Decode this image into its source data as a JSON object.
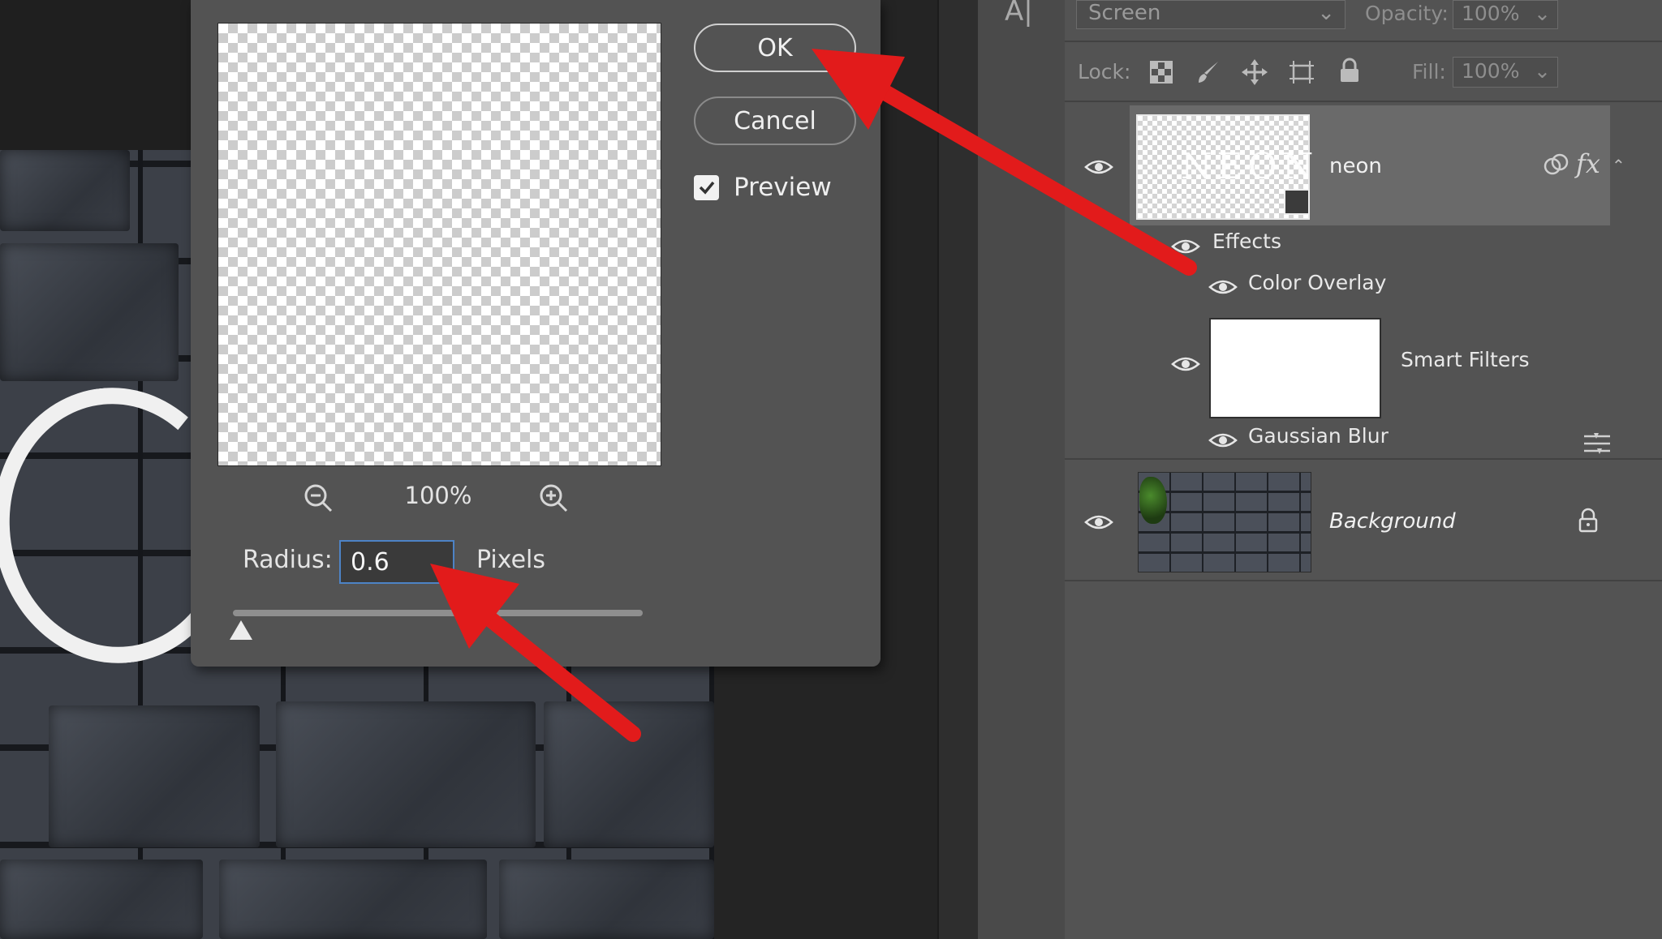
{
  "dialog": {
    "ok_label": "OK",
    "cancel_label": "Cancel",
    "preview_label": "Preview",
    "preview_checked": true,
    "zoom_level": "100%",
    "radius_label": "Radius:",
    "radius_value": "0.6",
    "pixels_label": "Pixels",
    "slider_level": 0.02
  },
  "layers_panel": {
    "blend_mode": "Screen",
    "opacity_label": "Opacity:",
    "opacity_value": "100%",
    "lock_label": "Lock:",
    "fill_label": "Fill:",
    "fill_value": "100%",
    "layers": {
      "neon": {
        "name": "neon",
        "thumb_text": "NEON",
        "fx_label": "fx"
      },
      "effects_label": "Effects",
      "color_overlay_label": "Color Overlay",
      "smart_filters_label": "Smart Filters",
      "gaussian_blur_label": "Gaussian Blur",
      "background": {
        "name": "Background"
      }
    }
  },
  "annotation_color": "#e21b1b"
}
